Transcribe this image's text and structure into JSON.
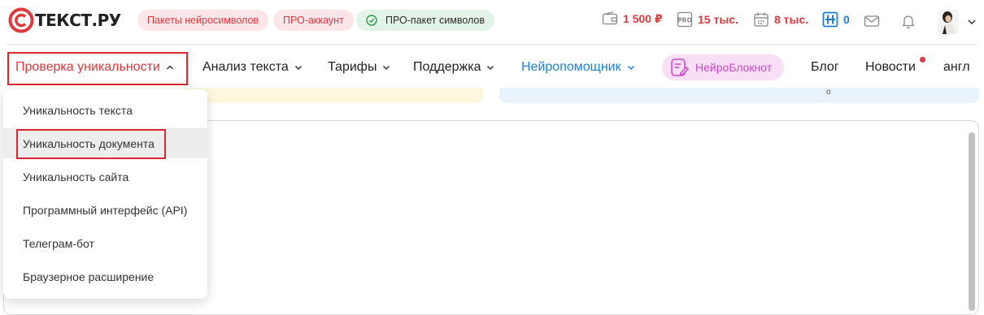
{
  "brand": {
    "name": "ТЕКСТ.РУ"
  },
  "promo_pills": [
    {
      "label": "Пакеты нейросимволов"
    },
    {
      "label": "ПРО-аккаунт"
    },
    {
      "label": "ПРО-пакет символов",
      "icon": "check-circle-icon"
    }
  ],
  "stats": {
    "balance": "1 500 ₽",
    "pro_symbols": "15 тыс.",
    "daily_symbols": "8 тыс.",
    "neuro_symbols": "0"
  },
  "nav": {
    "items": [
      {
        "label": "Проверка уникальности",
        "active": true
      },
      {
        "label": "Анализ текста"
      },
      {
        "label": "Тарифы"
      },
      {
        "label": "Поддержка"
      },
      {
        "label": "Нейропомощник"
      },
      {
        "label": "НейроБлокнот"
      },
      {
        "label": "Блог"
      },
      {
        "label": "Новости"
      },
      {
        "label": "англ"
      }
    ]
  },
  "dropdown": {
    "items": [
      {
        "label": "Уникальность текста"
      },
      {
        "label": "Уникальность документа",
        "highlighted": true
      },
      {
        "label": "Уникальность сайта"
      },
      {
        "label": "Программный интерфейс (API)"
      },
      {
        "label": "Телеграм-бот"
      },
      {
        "label": "Браузерное расширение"
      }
    ]
  },
  "banner_mark": "о",
  "colors": {
    "brand_red": "#e0393e",
    "link_blue": "#1d7fd8",
    "neuro_pink": "#cc49c7"
  }
}
